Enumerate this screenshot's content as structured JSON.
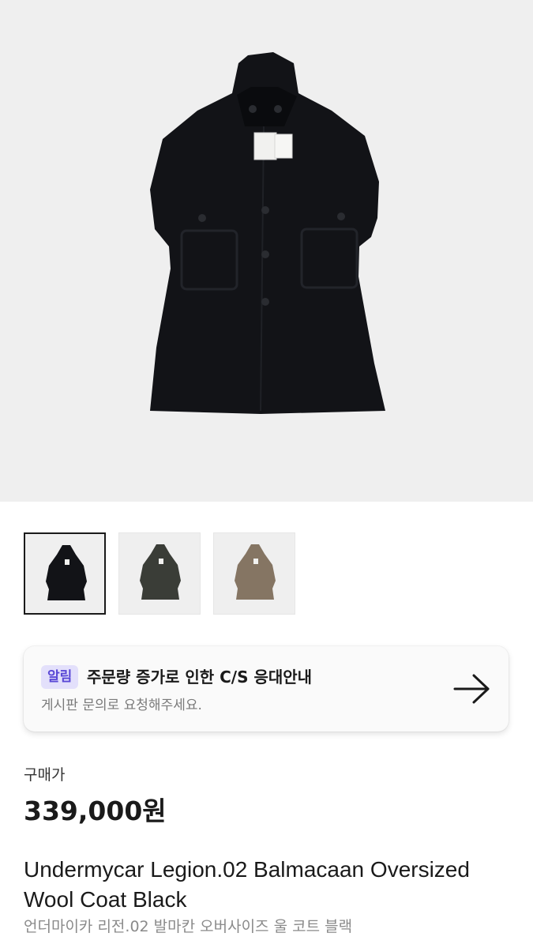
{
  "product": {
    "main_image_icon": "coat-photo",
    "thumbnails": [
      {
        "icon": "coat-thumb-black",
        "color": "#121317",
        "selected": true
      },
      {
        "icon": "coat-thumb-olive",
        "color": "#3a3d37",
        "selected": false
      },
      {
        "icon": "coat-thumb-taupe",
        "color": "#857563",
        "selected": false
      }
    ],
    "notice": {
      "badge": "알림",
      "title": "주문량 증가로 인한 C/S 응대안내",
      "subtitle": "게시판 문의로 요청해주세요.",
      "arrow_icon": "arrow-right-icon"
    },
    "price_label": "구매가",
    "price": "339,000원",
    "title_en": "Undermycar Legion.02 Balmacaan Oversized Wool Coat Black",
    "title_ko": "언더마이카 리전.02 발마칸 오버사이즈 울 코트 블랙"
  },
  "colors": {
    "badge_bg": "#e3e0fb",
    "badge_text": "#5a48d6",
    "coat_black": "#121317"
  }
}
